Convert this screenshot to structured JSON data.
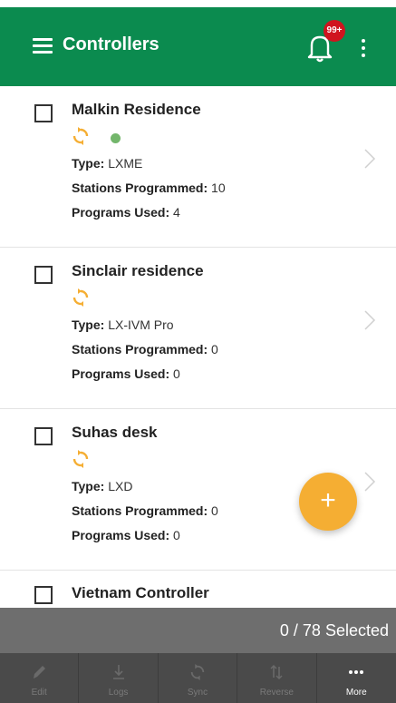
{
  "header": {
    "title": "Controllers",
    "badge": "99+",
    "bar_color": "#0b8b4f"
  },
  "controllers": [
    {
      "name": "Malkin Residence",
      "online": true,
      "type_label": "Type:",
      "type": "LXME",
      "stations_label": "Stations Programmed:",
      "stations": "10",
      "programs_label": "Programs Used:",
      "programs": "4"
    },
    {
      "name": "Sinclair residence",
      "online": false,
      "type_label": "Type:",
      "type": "LX-IVM Pro",
      "stations_label": "Stations Programmed:",
      "stations": "0",
      "programs_label": "Programs Used:",
      "programs": "0"
    },
    {
      "name": "Suhas desk",
      "online": false,
      "type_label": "Type:",
      "type": "LXD",
      "stations_label": "Stations Programmed:",
      "stations": "0",
      "programs_label": "Programs Used:",
      "programs": "0"
    },
    {
      "name": "Vietnam Controller"
    }
  ],
  "fab": {
    "label": "+"
  },
  "selection": {
    "text": "0 / 78 Selected"
  },
  "toolbar": {
    "items": [
      {
        "label": "Edit",
        "icon": "pencil-icon",
        "enabled": false
      },
      {
        "label": "Logs",
        "icon": "download-icon",
        "enabled": false
      },
      {
        "label": "Sync",
        "icon": "sync-icon",
        "enabled": false
      },
      {
        "label": "Reverse",
        "icon": "reverse-icon",
        "enabled": false
      },
      {
        "label": "More",
        "icon": "more-icon",
        "enabled": true
      }
    ]
  },
  "colors": {
    "accent_orange": "#f5ae33",
    "status_green": "#73b66b",
    "badge_red": "#d0141e"
  }
}
